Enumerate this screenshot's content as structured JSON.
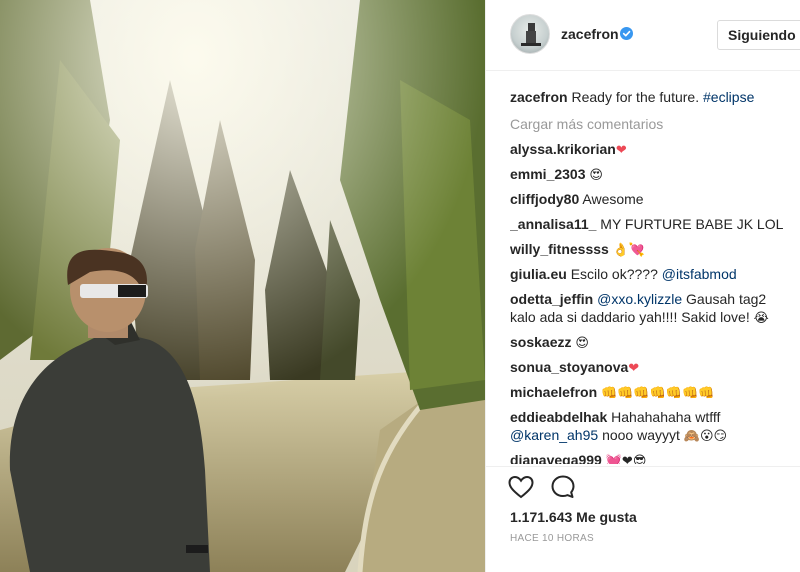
{
  "post": {
    "username": "zacefron",
    "follow_label": "Siguiendo",
    "caption_text": "Ready for the future.",
    "caption_tag": "#eclipse",
    "load_more": "Cargar más comentarios",
    "likes": "1.171.643 Me gusta",
    "time": "HACE 10 HORAS"
  },
  "comments": [
    {
      "user": "alyssa.krikorian",
      "text": "",
      "emoji": "❤"
    },
    {
      "user": "emmi_2303",
      "text": "",
      "emoji": "😍"
    },
    {
      "user": "cliffjody80",
      "text": "Awesome",
      "emoji": ""
    },
    {
      "user": "_annalisa11_",
      "text": "MY FURTURE BABE JK LOL",
      "emoji": ""
    },
    {
      "user": "willy_fitnessss",
      "text": "",
      "emoji": "👌💘"
    },
    {
      "user": "giulia.eu",
      "text": "Escilo ok????",
      "mention": "@itsfabmod",
      "emoji": ""
    },
    {
      "user": "odetta_jeffin",
      "mention": "@xxo.kylizzle",
      "text": "Gausah tag2 kalo ada si daddario yah!!!! Sakid love!",
      "emoji": "😭"
    },
    {
      "user": "soskaezz",
      "text": "",
      "emoji": "😍"
    },
    {
      "user": "sonua_stoyanova",
      "text": "",
      "emoji": "❤"
    },
    {
      "user": "michaelefron",
      "text": "",
      "emoji": "👊👊👊👊👊👊👊"
    },
    {
      "user": "eddieabdelhak",
      "text": "Hahahahaha wtfff",
      "mention": "@karen_ah95",
      "text2": "nooo wayyyt",
      "emoji": "🙈😮😏"
    },
    {
      "user": "dianavega999",
      "text": "",
      "emoji": "💓❤😎"
    }
  ],
  "colors": {
    "link": "#003569",
    "verified": "#3897f0",
    "muted": "#999999"
  },
  "icons": [
    "verified-badge-icon",
    "heart-icon",
    "comment-icon"
  ]
}
